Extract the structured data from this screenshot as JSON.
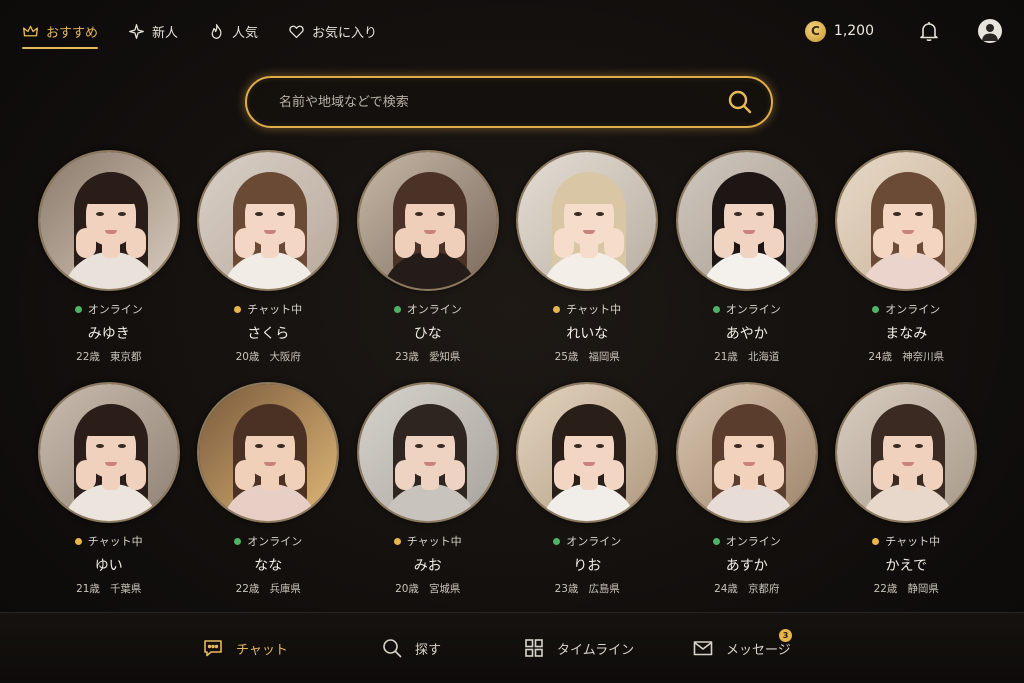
{
  "top_nav": {
    "tabs": [
      {
        "label": "おすすめ",
        "icon": "crown-icon",
        "active": true
      },
      {
        "label": "新人",
        "icon": "sparkle-icon",
        "active": false
      },
      {
        "label": "人気",
        "icon": "flame-icon",
        "active": false
      },
      {
        "label": "お気に入り",
        "icon": "heart-icon",
        "active": false
      }
    ],
    "coin_symbol": "C",
    "coin_balance": "1,200"
  },
  "search": {
    "placeholder": "名前や地域などで検索"
  },
  "colors": {
    "accent": "#e8b95a",
    "online": "#4fb365",
    "chatting": "#e8b54a"
  },
  "profiles": [
    {
      "status": "オンライン",
      "status_type": "online",
      "name": "みゆき",
      "age": "22歳",
      "location": "東京都"
    },
    {
      "status": "チャット中",
      "status_type": "chat",
      "name": "さくら",
      "age": "20歳",
      "location": "大阪府"
    },
    {
      "status": "オンライン",
      "status_type": "online",
      "name": "ひな",
      "age": "23歳",
      "location": "愛知県"
    },
    {
      "status": "チャット中",
      "status_type": "chat",
      "name": "れいな",
      "age": "25歳",
      "location": "福岡県"
    },
    {
      "status": "オンライン",
      "status_type": "online",
      "name": "あやか",
      "age": "21歳",
      "location": "北海道"
    },
    {
      "status": "オンライン",
      "status_type": "online",
      "name": "まなみ",
      "age": "24歳",
      "location": "神奈川県"
    },
    {
      "status": "チャット中",
      "status_type": "chat",
      "name": "ゆい",
      "age": "21歳",
      "location": "千葉県"
    },
    {
      "status": "オンライン",
      "status_type": "online",
      "name": "なな",
      "age": "22歳",
      "location": "兵庫県"
    },
    {
      "status": "チャット中",
      "status_type": "chat",
      "name": "みお",
      "age": "20歳",
      "location": "宮城県"
    },
    {
      "status": "オンライン",
      "status_type": "online",
      "name": "りお",
      "age": "23歳",
      "location": "広島県"
    },
    {
      "status": "オンライン",
      "status_type": "online",
      "name": "あすか",
      "age": "24歳",
      "location": "京都府"
    },
    {
      "status": "チャット中",
      "status_type": "chat",
      "name": "かえで",
      "age": "22歳",
      "location": "静岡県"
    }
  ],
  "bottom_nav": {
    "chat": "チャット",
    "search": "探す",
    "timeline": "タイムライン",
    "messages": "メッセージ",
    "messages_badge": "3"
  }
}
